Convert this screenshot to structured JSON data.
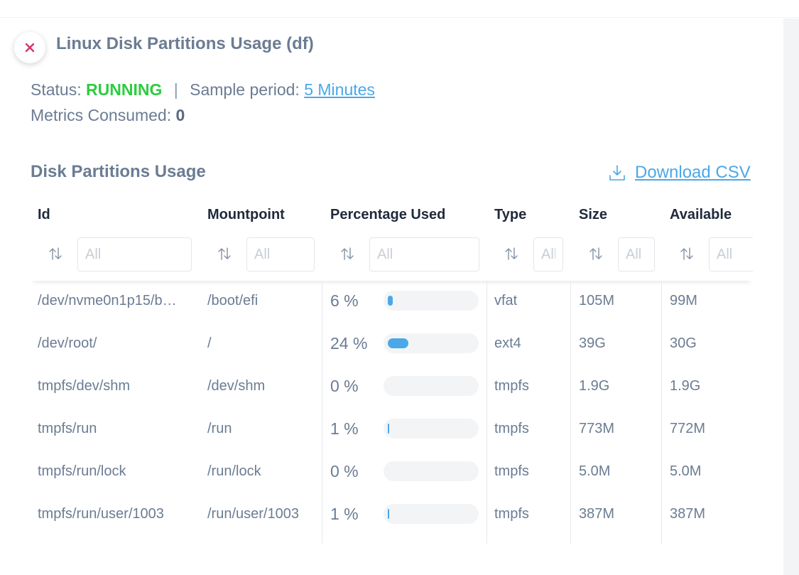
{
  "title": "Linux Disk Partitions Usage (df)",
  "status": {
    "label": "Status:",
    "value": "RUNNING",
    "separator": "|",
    "sample_label": "Sample period:",
    "sample_value": "5 Minutes"
  },
  "metrics": {
    "label": "Metrics Consumed:",
    "value": "0"
  },
  "section_title": "Disk Partitions Usage",
  "download_label": "Download CSV",
  "filter_placeholder": "All",
  "columns": [
    "Id",
    "Mountpoint",
    "Percentage Used",
    "Type",
    "Size",
    "Available"
  ],
  "rows": [
    {
      "id": "/dev/nvme0n1p15/b…",
      "mountpoint": "/boot/efi",
      "pct_label": "6 %",
      "pct": 6,
      "type": "vfat",
      "size": "105M",
      "available": "99M"
    },
    {
      "id": "/dev/root/",
      "mountpoint": "/",
      "pct_label": "24 %",
      "pct": 24,
      "type": "ext4",
      "size": "39G",
      "available": "30G"
    },
    {
      "id": "tmpfs/dev/shm",
      "mountpoint": "/dev/shm",
      "pct_label": "0 %",
      "pct": 0,
      "type": "tmpfs",
      "size": "1.9G",
      "available": "1.9G"
    },
    {
      "id": "tmpfs/run",
      "mountpoint": "/run",
      "pct_label": "1 %",
      "pct": 1,
      "type": "tmpfs",
      "size": "773M",
      "available": "772M"
    },
    {
      "id": "tmpfs/run/lock",
      "mountpoint": "/run/lock",
      "pct_label": "0 %",
      "pct": 0,
      "type": "tmpfs",
      "size": "5.0M",
      "available": "5.0M"
    },
    {
      "id": "tmpfs/run/user/1003",
      "mountpoint": "/run/user/1003",
      "pct_label": "1 %",
      "pct": 1,
      "type": "tmpfs",
      "size": "387M",
      "available": "387M"
    }
  ],
  "colors": {
    "accent": "#4aa8e8",
    "running": "#2ecc40",
    "close": "#d6336c",
    "text": "#6b7c93",
    "header_text": "#1e2a3a"
  },
  "icons": {
    "close": "close-icon",
    "download": "download-icon",
    "sort": "sort-arrows-icon"
  }
}
